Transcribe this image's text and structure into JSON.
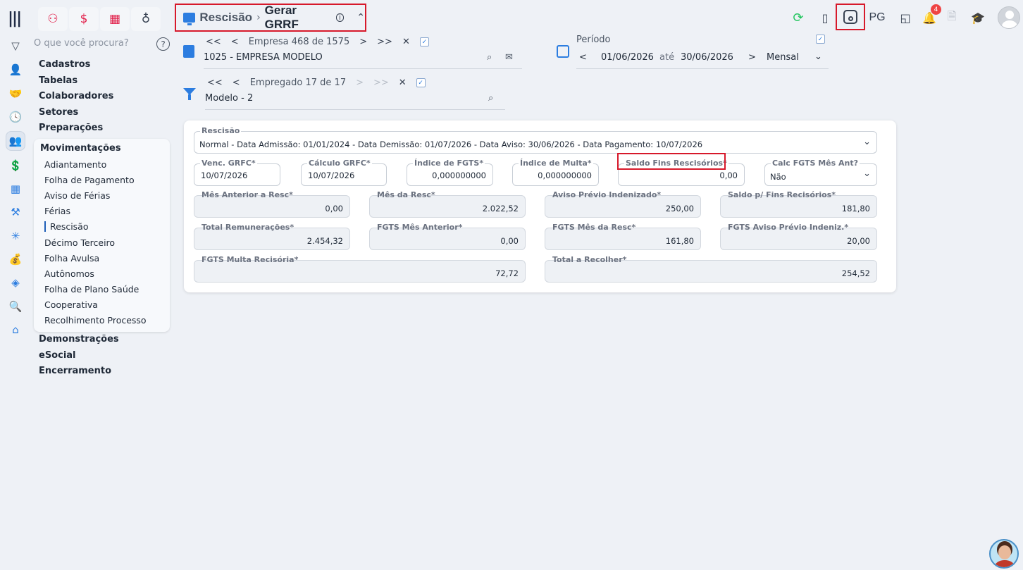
{
  "header": {
    "breadcrumb_section": "Rescisão",
    "breadcrumb_separator": "›",
    "breadcrumb_page": "Gerar GRRF",
    "info_glyph": "i",
    "collapse_glyph": "⌃",
    "pg_label": "PG",
    "notifications_count": "4"
  },
  "sidebar": {
    "search_placeholder": "O que você procura?",
    "help_glyph": "?",
    "menu_top": [
      "Cadastros",
      "Tabelas",
      "Colaboradores",
      "Setores",
      "Preparações"
    ],
    "group_title": "Movimentações",
    "group_items": [
      "Adiantamento",
      "Folha de Pagamento",
      "Aviso de Férias",
      "Férias",
      "Rescisão",
      "Décimo Terceiro",
      "Folha Avulsa",
      "Autônomos",
      "Folha de Plano Saúde",
      "Cooperativa",
      "Recolhimento Processo"
    ],
    "active_item": "Rescisão",
    "menu_bottom": [
      "Demonstrações",
      "eSocial",
      "Encerramento"
    ]
  },
  "empresa": {
    "first": "<<",
    "prev": "<",
    "label": "Empresa",
    "current": "468",
    "of": "de",
    "total": "1575",
    "next": ">",
    "last": ">>",
    "clear": "✕",
    "check": "✓",
    "value": "1025 - EMPRESA MODELO"
  },
  "empregado": {
    "first": "<<",
    "prev": "<",
    "label": "Empregado",
    "current": "17",
    "of": "de",
    "total": "17",
    "next": ">",
    "last": ">>",
    "clear": "✕",
    "check": "✓",
    "value": "Modelo - 2"
  },
  "periodo": {
    "label": "Período",
    "check": "✓",
    "prev": "<",
    "start": "01/06/2026",
    "until": "até",
    "end": "30/06/2026",
    "next": ">",
    "mode": "Mensal"
  },
  "form": {
    "rescisao_label": "Rescisão",
    "rescisao_value": "Normal - Data Admissão: 01/01/2024 - Data Demissão: 01/07/2026 - Data Aviso: 30/06/2026 - Data Pagamento: 10/07/2026",
    "venc_grfc_label": "Venc. GRFC*",
    "venc_grfc_value": "10/07/2026",
    "calc_grfc_label": "Cálculo GRFC*",
    "calc_grfc_value": "10/07/2026",
    "indice_fgts_label": "Índice de FGTS*",
    "indice_fgts_value": "0,000000000",
    "indice_multa_label": "Índice de Multa*",
    "indice_multa_value": "0,000000000",
    "saldo_fins_label": "Saldo Fins Rescisórios*",
    "saldo_fins_value": "0,00",
    "calc_fgts_label": "Calc FGTS Mês Ant?",
    "calc_fgts_value": "Não",
    "mes_anterior_label": "Mês Anterior a Resc*",
    "mes_anterior_value": "0,00",
    "mes_resc_label": "Mês da Resc*",
    "mes_resc_value": "2.022,52",
    "aviso_label": "Aviso Prévio Indenizado*",
    "aviso_value": "250,00",
    "saldo_p_fins_label": "Saldo p/ Fins Recisórios*",
    "saldo_p_fins_value": "181,80",
    "total_remun_label": "Total Remunerações*",
    "total_remun_value": "2.454,32",
    "fgts_mes_ant_label": "FGTS Mês Anterior*",
    "fgts_mes_ant_value": "0,00",
    "fgts_mes_resc_label": "FGTS Mês da Resc*",
    "fgts_mes_resc_value": "161,80",
    "fgts_aviso_label": "FGTS Aviso Prévio Indeniz.*",
    "fgts_aviso_value": "20,00",
    "fgts_multa_label": "FGTS Multa Recisória*",
    "fgts_multa_value": "72,72",
    "total_recolher_label": "Total a Recolher*",
    "total_recolher_value": "254,52"
  },
  "colors": {
    "accent": "#2c7de0",
    "highlight": "#d7192b",
    "background": "#eef1f6"
  }
}
